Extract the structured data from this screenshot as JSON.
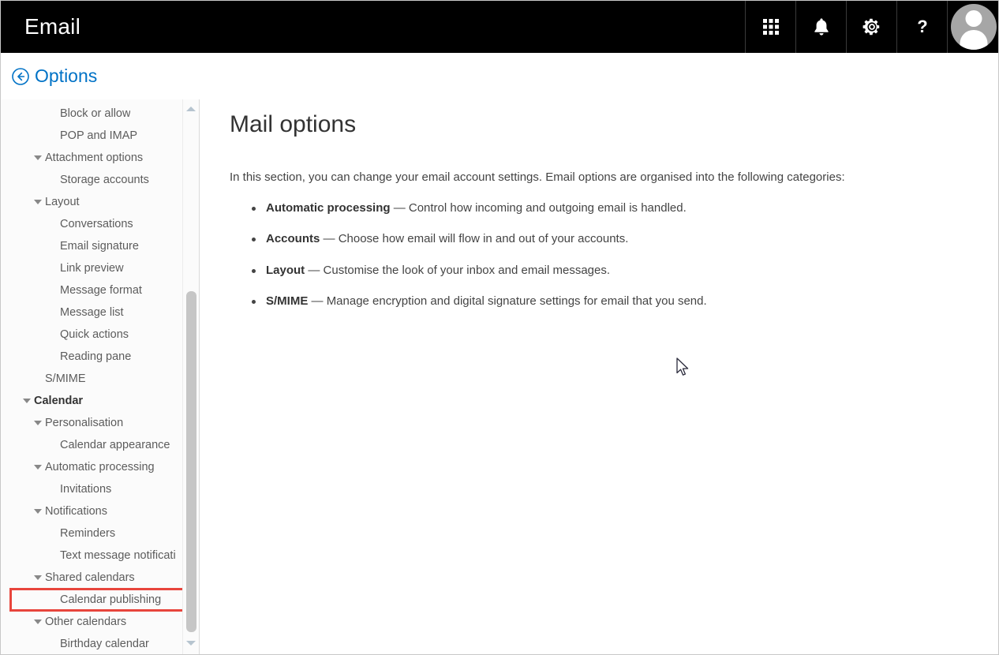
{
  "header": {
    "title": "Email",
    "actions": [
      {
        "name": "app-launcher",
        "icon": "grid-icon",
        "label": "App launcher"
      },
      {
        "name": "notifications",
        "icon": "bell-icon",
        "label": "Notifications"
      },
      {
        "name": "settings",
        "icon": "gear-icon",
        "label": "Settings"
      },
      {
        "name": "help",
        "icon": "question-mark-icon",
        "label": "?"
      }
    ],
    "avatar_label": "Account manager"
  },
  "options_bar": {
    "back_label": "Options",
    "back_icon": "back-circle-arrow-icon"
  },
  "sidebar": {
    "items": [
      {
        "label": "Block or allow",
        "level": 2,
        "expandable": false,
        "bold": false,
        "highlighted": false
      },
      {
        "label": "POP and IMAP",
        "level": 2,
        "expandable": false,
        "bold": false,
        "highlighted": false
      },
      {
        "label": "Attachment options",
        "level": 1,
        "expandable": true,
        "bold": false,
        "highlighted": false
      },
      {
        "label": "Storage accounts",
        "level": 2,
        "expandable": false,
        "bold": false,
        "highlighted": false
      },
      {
        "label": "Layout",
        "level": 1,
        "expandable": true,
        "bold": false,
        "highlighted": false
      },
      {
        "label": "Conversations",
        "level": 2,
        "expandable": false,
        "bold": false,
        "highlighted": false
      },
      {
        "label": "Email signature",
        "level": 2,
        "expandable": false,
        "bold": false,
        "highlighted": false
      },
      {
        "label": "Link preview",
        "level": 2,
        "expandable": false,
        "bold": false,
        "highlighted": false
      },
      {
        "label": "Message format",
        "level": 2,
        "expandable": false,
        "bold": false,
        "highlighted": false
      },
      {
        "label": "Message list",
        "level": 2,
        "expandable": false,
        "bold": false,
        "highlighted": false
      },
      {
        "label": "Quick actions",
        "level": 2,
        "expandable": false,
        "bold": false,
        "highlighted": false
      },
      {
        "label": "Reading pane",
        "level": 2,
        "expandable": false,
        "bold": false,
        "highlighted": false
      },
      {
        "label": "S/MIME",
        "level": 1,
        "expandable": false,
        "bold": false,
        "highlighted": false
      },
      {
        "label": "Calendar",
        "level": 0,
        "expandable": true,
        "bold": true,
        "highlighted": false
      },
      {
        "label": "Personalisation",
        "level": 1,
        "expandable": true,
        "bold": false,
        "highlighted": false
      },
      {
        "label": "Calendar appearance",
        "level": 2,
        "expandable": false,
        "bold": false,
        "highlighted": false
      },
      {
        "label": "Automatic processing",
        "level": 1,
        "expandable": true,
        "bold": false,
        "highlighted": false
      },
      {
        "label": "Invitations",
        "level": 2,
        "expandable": false,
        "bold": false,
        "highlighted": false
      },
      {
        "label": "Notifications",
        "level": 1,
        "expandable": true,
        "bold": false,
        "highlighted": false
      },
      {
        "label": "Reminders",
        "level": 2,
        "expandable": false,
        "bold": false,
        "highlighted": false
      },
      {
        "label": "Text message notificati",
        "level": 2,
        "expandable": false,
        "bold": false,
        "highlighted": false
      },
      {
        "label": "Shared calendars",
        "level": 1,
        "expandable": true,
        "bold": false,
        "highlighted": false
      },
      {
        "label": "Calendar publishing",
        "level": 2,
        "expandable": false,
        "bold": false,
        "highlighted": true
      },
      {
        "label": "Other calendars",
        "level": 1,
        "expandable": true,
        "bold": false,
        "highlighted": false
      },
      {
        "label": "Birthday calendar",
        "level": 2,
        "expandable": false,
        "bold": false,
        "highlighted": false
      }
    ],
    "scrollbar": {
      "up_arrow": "scroll-up-arrow",
      "down_arrow": "scroll-down-arrow"
    },
    "highlight_color": "#e8453c"
  },
  "main": {
    "title": "Mail options",
    "intro": "In this section, you can change your email account settings. Email options are organised into the following categories:",
    "categories": [
      {
        "term": "Automatic processing",
        "dash": " — ",
        "desc": "Control how incoming and outgoing email is handled."
      },
      {
        "term": "Accounts",
        "dash": " — ",
        "desc": "Choose how email will flow in and out of your accounts."
      },
      {
        "term": "Layout",
        "dash": " — ",
        "desc": "Customise the look of your inbox and email messages."
      },
      {
        "term": "S/MIME",
        "dash": " — ",
        "desc": "Manage encryption and digital signature settings for email that you send."
      }
    ]
  },
  "colors": {
    "header_bg": "#000000",
    "accent_blue": "#0072c6",
    "highlight_red": "#e8453c",
    "sidebar_bg": "#fbfbfb"
  }
}
